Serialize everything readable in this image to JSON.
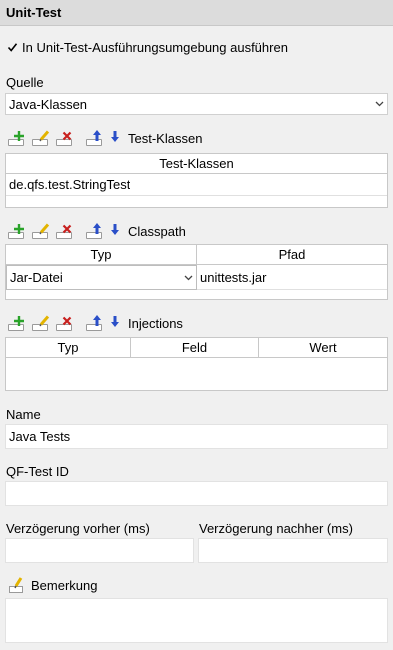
{
  "header": {
    "title": "Unit-Test"
  },
  "run_in_env": {
    "label": "In Unit-Test-Ausführungsumgebung ausführen",
    "checked": true
  },
  "source": {
    "label": "Quelle",
    "selected": "Java-Klassen"
  },
  "test_classes": {
    "toolbar_label": "Test-Klassen",
    "column": "Test-Klassen",
    "rows": [
      "de.qfs.test.StringTest"
    ]
  },
  "classpath": {
    "toolbar_label": "Classpath",
    "columns": [
      "Typ",
      "Pfad"
    ],
    "rows": [
      {
        "type": "Jar-Datei",
        "path": "unittests.jar"
      }
    ]
  },
  "injections": {
    "toolbar_label": "Injections",
    "columns": [
      "Typ",
      "Feld",
      "Wert"
    ]
  },
  "name": {
    "label": "Name",
    "value": "Java Tests"
  },
  "qftest_id": {
    "label": "QF-Test ID",
    "value": ""
  },
  "delay_before": {
    "label": "Verzögerung vorher (ms)",
    "value": ""
  },
  "delay_after": {
    "label": "Verzögerung nachher (ms)",
    "value": ""
  },
  "comment": {
    "label": "Bemerkung",
    "value": ""
  },
  "colors": {
    "add": "#2aa32a",
    "edit": "#e3b400",
    "delete": "#c8201e",
    "move": "#2a4fc8"
  },
  "icons": [
    "add-icon",
    "edit-icon",
    "delete-icon",
    "move-up-icon",
    "move-down-icon",
    "chevron-down-icon",
    "checkmark-icon",
    "pencil-icon"
  ]
}
